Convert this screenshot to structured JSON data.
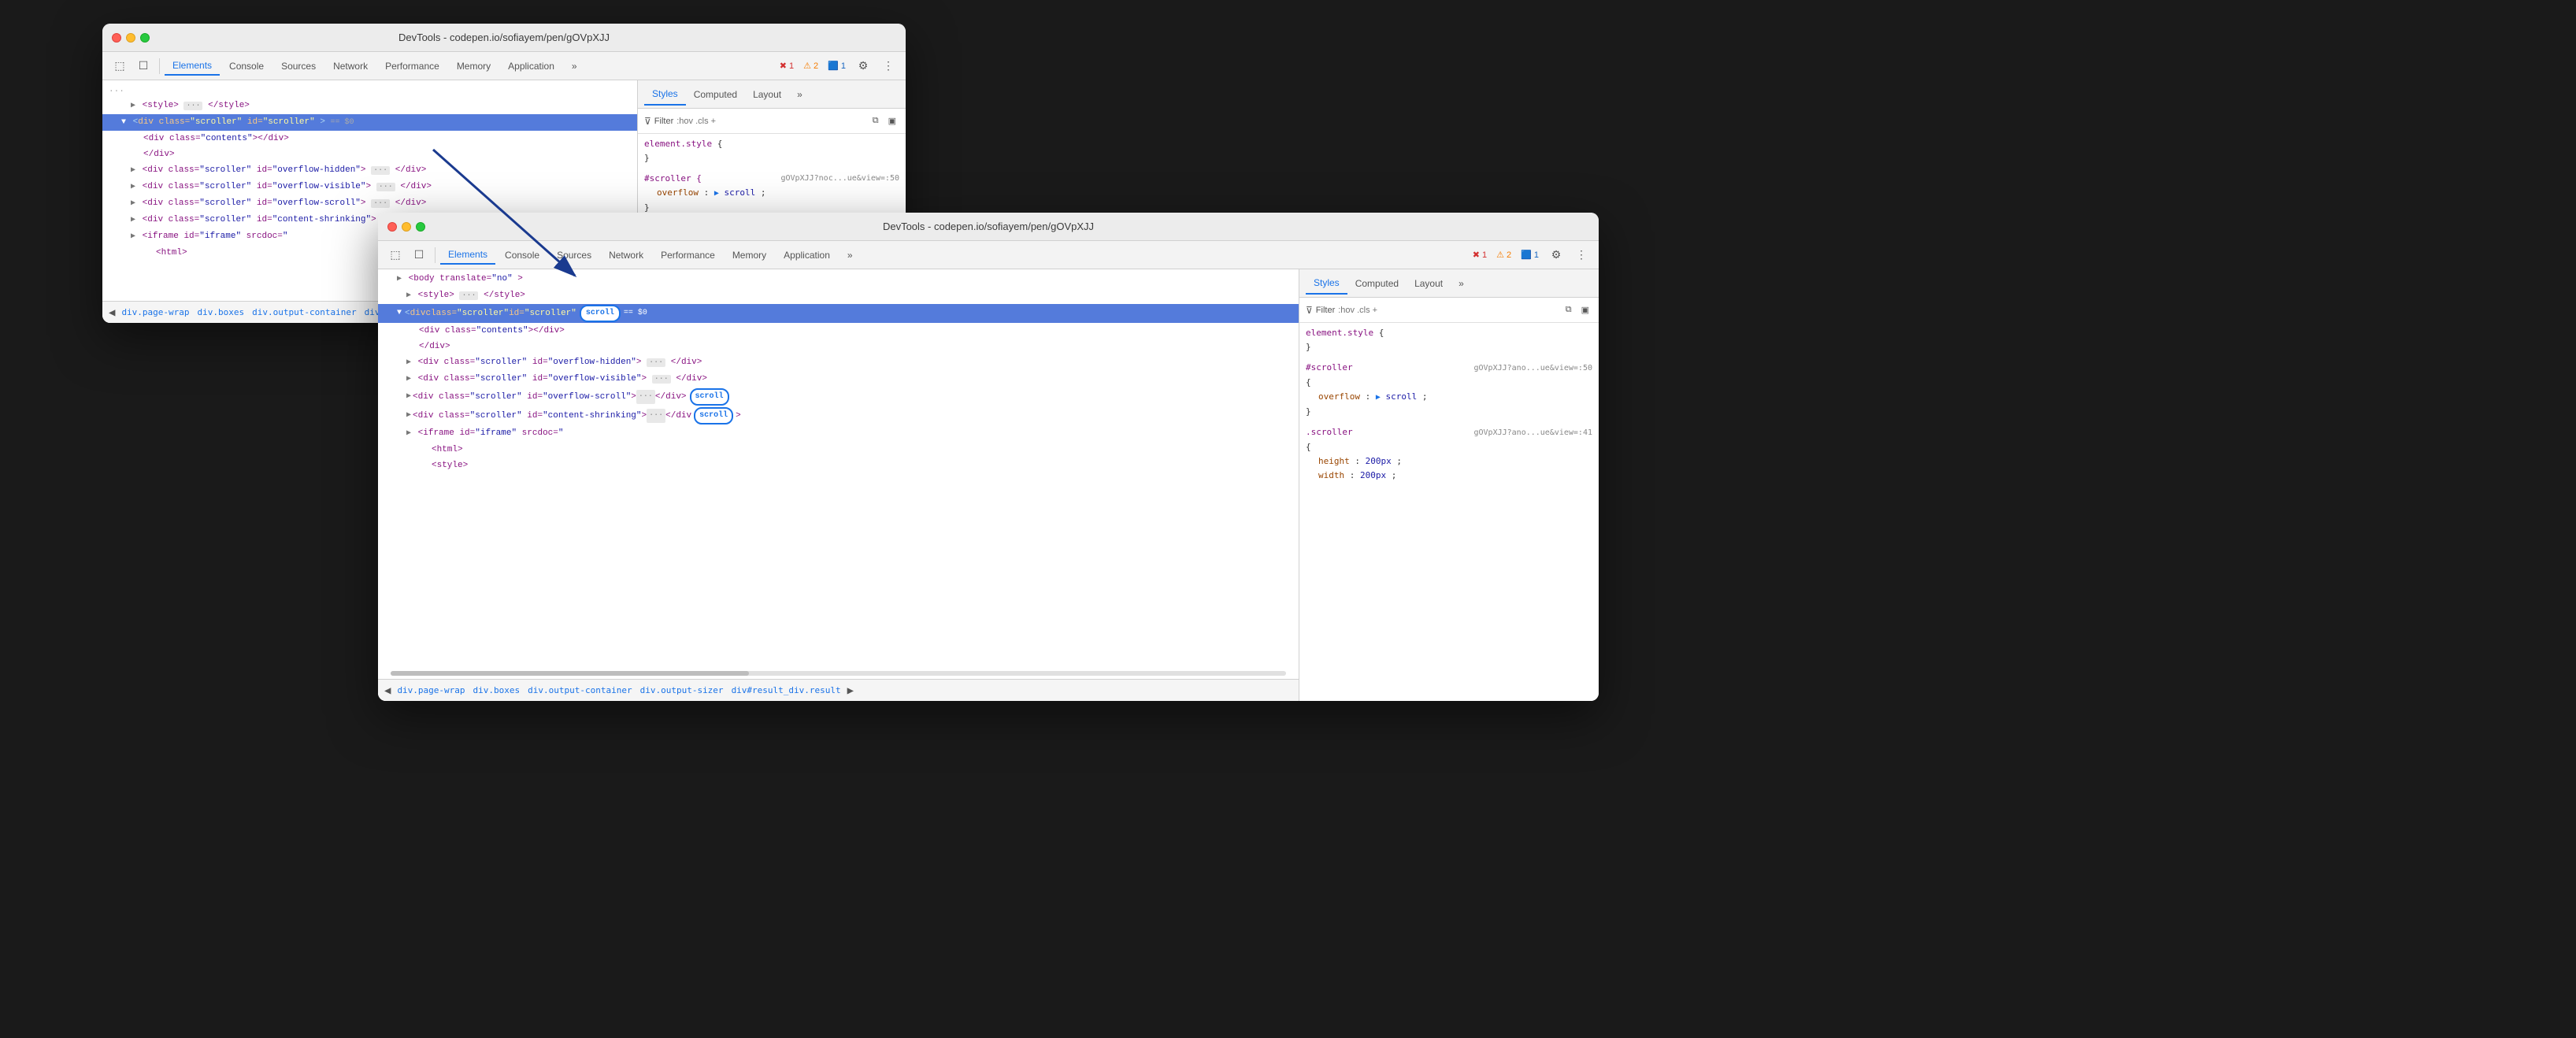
{
  "window1": {
    "title": "DevTools - codepen.io/sofiayem/pen/gOVpXJJ",
    "tabs": [
      "Elements",
      "Console",
      "Sources",
      "Network",
      "Performance",
      "Memory",
      "Application",
      ">>"
    ],
    "active_tab": "Elements",
    "dom_lines": [
      {
        "text": "<style> ··· </style>",
        "indent": 1,
        "type": "normal"
      },
      {
        "text": "<div class=\"scroller\" id=\"scroller\"> == $0",
        "indent": 1,
        "type": "selected-active",
        "has_badge": false
      },
      {
        "text": "<div class=\"contents\"></div>",
        "indent": 2,
        "type": "normal"
      },
      {
        "text": "</div>",
        "indent": 2,
        "type": "normal"
      },
      {
        "text": "<div class=\"scroller\" id=\"overflow-hidden\"> ··· </div>",
        "indent": 1,
        "type": "normal"
      },
      {
        "text": "<div class=\"scroller\" id=\"overflow-visible\"> ··· </div>",
        "indent": 1,
        "type": "normal"
      },
      {
        "text": "<div class=\"scroller\" id=\"overflow-scroll\"> ··· </div>",
        "indent": 1,
        "type": "normal"
      },
      {
        "text": "<div class=\"scroller\" id=\"content-shrinking\"> ··· </div>",
        "indent": 1,
        "type": "normal"
      },
      {
        "text": "<iframe id=\"iframe\" srcdoc=\"",
        "indent": 1,
        "type": "normal"
      },
      {
        "text": "<html>",
        "indent": 3,
        "type": "normal"
      }
    ],
    "breadcrumbs": [
      "div.page-wrap",
      "div.boxes",
      "div.output-container",
      "div.outp..."
    ],
    "styles": {
      "tabs": [
        "Styles",
        "Computed",
        "Layout",
        ">>"
      ],
      "active_tab": "Styles",
      "filter_placeholder": ":hov .cls +",
      "rules": [
        {
          "selector": "element.style {",
          "close": "}",
          "props": []
        },
        {
          "selector": "#scroller {",
          "url": "gOVpXJJ?noc...ue&view=:50",
          "props": [
            {
              "name": "overflow",
              "value": "▶ scroll",
              "is_link": true
            }
          ],
          "close": "}"
        }
      ]
    }
  },
  "window2": {
    "title": "DevTools - codepen.io/sofiayem/pen/gOVpXJJ",
    "tabs": [
      "Elements",
      "Console",
      "Sources",
      "Network",
      "Performance",
      "Memory",
      "Application",
      ">>"
    ],
    "active_tab": "Elements",
    "dom_lines": [
      {
        "text": "<body translate=\"no\" >",
        "indent": 0,
        "type": "normal"
      },
      {
        "text": "<style> ··· </style>",
        "indent": 1,
        "type": "normal"
      },
      {
        "text": "<div class=\"scroller\" id=\"scroller\"",
        "indent": 1,
        "type": "selected-active",
        "badge": "scroll",
        "has_dollar": true
      },
      {
        "text": "<div class=\"contents\"></div>",
        "indent": 2,
        "type": "normal"
      },
      {
        "text": "</div>",
        "indent": 2,
        "type": "normal"
      },
      {
        "text": "<div class=\"scroller\" id=\"overflow-hidden\"> ··· </div>",
        "indent": 1,
        "type": "normal"
      },
      {
        "text": "<div class=\"scroller\" id=\"overflow-visible\"> ··· </div>",
        "indent": 1,
        "type": "normal"
      },
      {
        "text": "<div class=\"scroller\" id=\"overflow-scroll\"> ··· </div>",
        "indent": 1,
        "type": "normal",
        "badge": "scroll"
      },
      {
        "text": "<div class=\"scroller\" id=\"content-shrinking\"> ··· </div>",
        "indent": 1,
        "type": "normal",
        "badge2": "scroll"
      },
      {
        "text": "<iframe id=\"iframe\" srcdoc=\"",
        "indent": 1,
        "type": "normal"
      },
      {
        "text": "<html>",
        "indent": 3,
        "type": "normal"
      },
      {
        "text": "<style>",
        "indent": 3,
        "type": "normal"
      }
    ],
    "breadcrumbs": [
      "div.page-wrap",
      "div.boxes",
      "div.output-container",
      "div.output-sizer",
      "div#result_div.result"
    ],
    "styles": {
      "tabs": [
        "Styles",
        "Computed",
        "Layout",
        ">>"
      ],
      "active_tab": "Styles",
      "filter_placeholder": ":hov .cls +",
      "rules": [
        {
          "selector": "element.style {",
          "close": "}",
          "props": []
        },
        {
          "selector": "#scroller",
          "url": "gOVpXJJ?ano...ue&view=:50",
          "props": [
            {
              "name": "overflow",
              "value": "▶ scroll"
            }
          ],
          "close": "}"
        },
        {
          "selector": ".scroller",
          "url": "gOVpXJJ?ano...ue&view=:41",
          "props": [
            {
              "name": "height",
              "value": "200px"
            },
            {
              "name": "width",
              "value": "200px"
            }
          ],
          "close": ""
        }
      ]
    }
  },
  "errors": {
    "red": "1",
    "orange": "2",
    "blue": "1"
  },
  "icons": {
    "cursor": "⬚",
    "inspect": "☐",
    "filter": "⊽",
    "gear": "⚙",
    "more": "⋮",
    "chevron_right": "»",
    "chevron_left": "◀",
    "hov": ":hov",
    "cls": ".cls",
    "plus": "+",
    "copy": "⧉",
    "computed_view": "▣"
  }
}
